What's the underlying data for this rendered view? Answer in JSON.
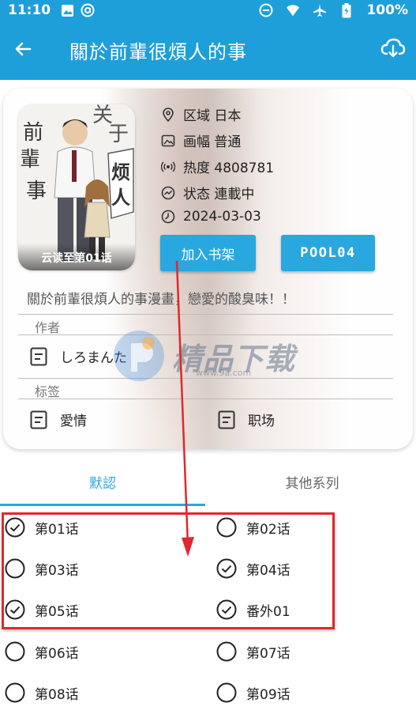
{
  "status_bar": {
    "time": "11:10",
    "battery": "100%"
  },
  "app_bar": {
    "title": "關於前輩很煩人的事"
  },
  "cover": {
    "caption": "云读至第01话"
  },
  "meta": {
    "region": "区域 日本",
    "format": "画幅 普通",
    "heat": "热度 4808781",
    "state": "状态 連載中",
    "date": "2024-03-03"
  },
  "buttons": {
    "favorite": "加入书架",
    "pool": "POOL04"
  },
  "description": "關於前輩很煩人的事漫畫，戀愛的酸臭味！！",
  "author": {
    "label": "作者",
    "name": "しろまんた"
  },
  "tags": {
    "label": "标签",
    "items": [
      "愛情",
      "职场"
    ]
  },
  "tabs": [
    "默認",
    "其他系列"
  ],
  "chapters": [
    {
      "label": "第01话",
      "checked": true
    },
    {
      "label": "第02话",
      "checked": false
    },
    {
      "label": "第03话",
      "checked": false
    },
    {
      "label": "第04话",
      "checked": true
    },
    {
      "label": "第05话",
      "checked": true
    },
    {
      "label": "番外01",
      "checked": true
    },
    {
      "label": "第06话",
      "checked": false
    },
    {
      "label": "第07话",
      "checked": false
    },
    {
      "label": "第08话",
      "checked": false
    },
    {
      "label": "第09话",
      "checked": false
    }
  ],
  "watermark": {
    "text": "精品下载",
    "url": "www.9a.com"
  },
  "colors": {
    "primary": "#1e9fd9",
    "accent": "#29a7df",
    "annotation": "#e0282e"
  },
  "icons": [
    "image-icon",
    "at-icon",
    "minus-circle-icon",
    "wifi-icon",
    "airplane-icon",
    "battery-icon",
    "back-arrow-icon",
    "cloud-download-icon",
    "location-icon",
    "picture-icon",
    "broadcast-icon",
    "trend-icon",
    "clock-icon",
    "document-icon",
    "check-circle-icon",
    "radio-empty-icon"
  ]
}
